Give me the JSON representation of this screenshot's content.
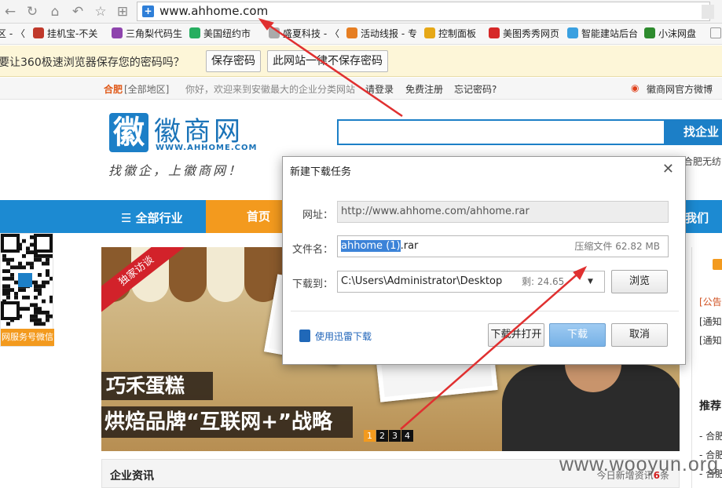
{
  "browser": {
    "address_url": "www.ahhome.com",
    "bookmarks": [
      {
        "label": "区 - 〈",
        "icon": "bookmark-icon"
      },
      {
        "label": "挂机宝-不关",
        "icon": "g-logo-icon",
        "color": "#c0392b"
      },
      {
        "label": "三角梨代码生",
        "icon": "flower-icon",
        "color": "#8e44ad"
      },
      {
        "label": "美国纽约市",
        "icon": "globe-icon",
        "color": "#27ae60"
      },
      {
        "label": "盛夏科技 - 〈",
        "icon": "page-icon",
        "color": "#aaaaaa"
      },
      {
        "label": "活动线报 - 专",
        "icon": "z-logo-icon",
        "color": "#e67e22"
      },
      {
        "label": "控制面板",
        "icon": "panel-icon",
        "color": "#e6a817"
      },
      {
        "label": "美图秀秀网页",
        "icon": "meitu-icon",
        "color": "#d62828"
      },
      {
        "label": "智能建站后台",
        "icon": "cloud-icon",
        "color": "#3aa0e0"
      },
      {
        "label": "小沫网盘",
        "icon": "tree-icon",
        "color": "#2e8b2e"
      }
    ]
  },
  "password_bar": {
    "message": "要让360极速浏览器保存您的密码吗？",
    "save_label": "保存密码",
    "never_label": "此网站一律不保存密码"
  },
  "site": {
    "strip": {
      "location_prefix": "合肥",
      "location_switch": "[全部地区]",
      "welcome": "你好，欢迎来到安徽最大的企业分类网站",
      "login": "请登录",
      "register": "免费注册",
      "forgot": "忘记密码?",
      "weibo": "徽商网官方微博"
    },
    "logo": {
      "glyph": "徽",
      "name": "徽商网",
      "domain": "WWW.AHHOME.COM",
      "slogan": "找徽企，上徽商网！"
    },
    "search": {
      "button_label": "找企业",
      "hot_word": "合肥无纺"
    },
    "nav": {
      "all_industries": "☰ 全部行业",
      "home": "首页",
      "right_item": "我们"
    },
    "qr_label": "网服务号微信",
    "banner": {
      "tag": "独家访谈",
      "title": "巧禾蛋糕",
      "subtitle": "烘焙品牌“互联网+”战略",
      "dots": [
        "1",
        "2",
        "3",
        "4"
      ],
      "active_dot": 0
    },
    "news": {
      "title": "企业资讯",
      "count_prefix": "今日新增资讯",
      "count": "6",
      "count_suffix": "条"
    },
    "right_col": {
      "notice_head": "[公告",
      "notice_1": "[通知",
      "notice_2": "[通知",
      "recommend": "推荐",
      "rec_1": "- 合肥",
      "rec_2": "- 合肥",
      "rec_3": "- 合肥"
    }
  },
  "dialog": {
    "title": "新建下载任务",
    "url_label": "网址：",
    "url_value": "http://www.ahhome.com/ahhome.rar",
    "filename_label": "文件名：",
    "filename_selected": "ahhome (1)",
    "filename_ext": ".rar",
    "file_info": "压缩文件 62.82 MB",
    "saveto_label": "下载到：",
    "saveto_value": "C:\\Users\\Administrator\\Desktop",
    "free_space": "剩: 24.65 GB",
    "browse_label": "浏览",
    "thunder_label": "使用迅雷下载",
    "download_open_label": "下载并打开",
    "download_label": "下载",
    "cancel_label": "取消"
  },
  "watermark": "www.wooyun.org",
  "colors": {
    "brand_blue": "#1c8ad2",
    "brand_orange": "#f39a1e",
    "annotation_red": "#e03030"
  }
}
